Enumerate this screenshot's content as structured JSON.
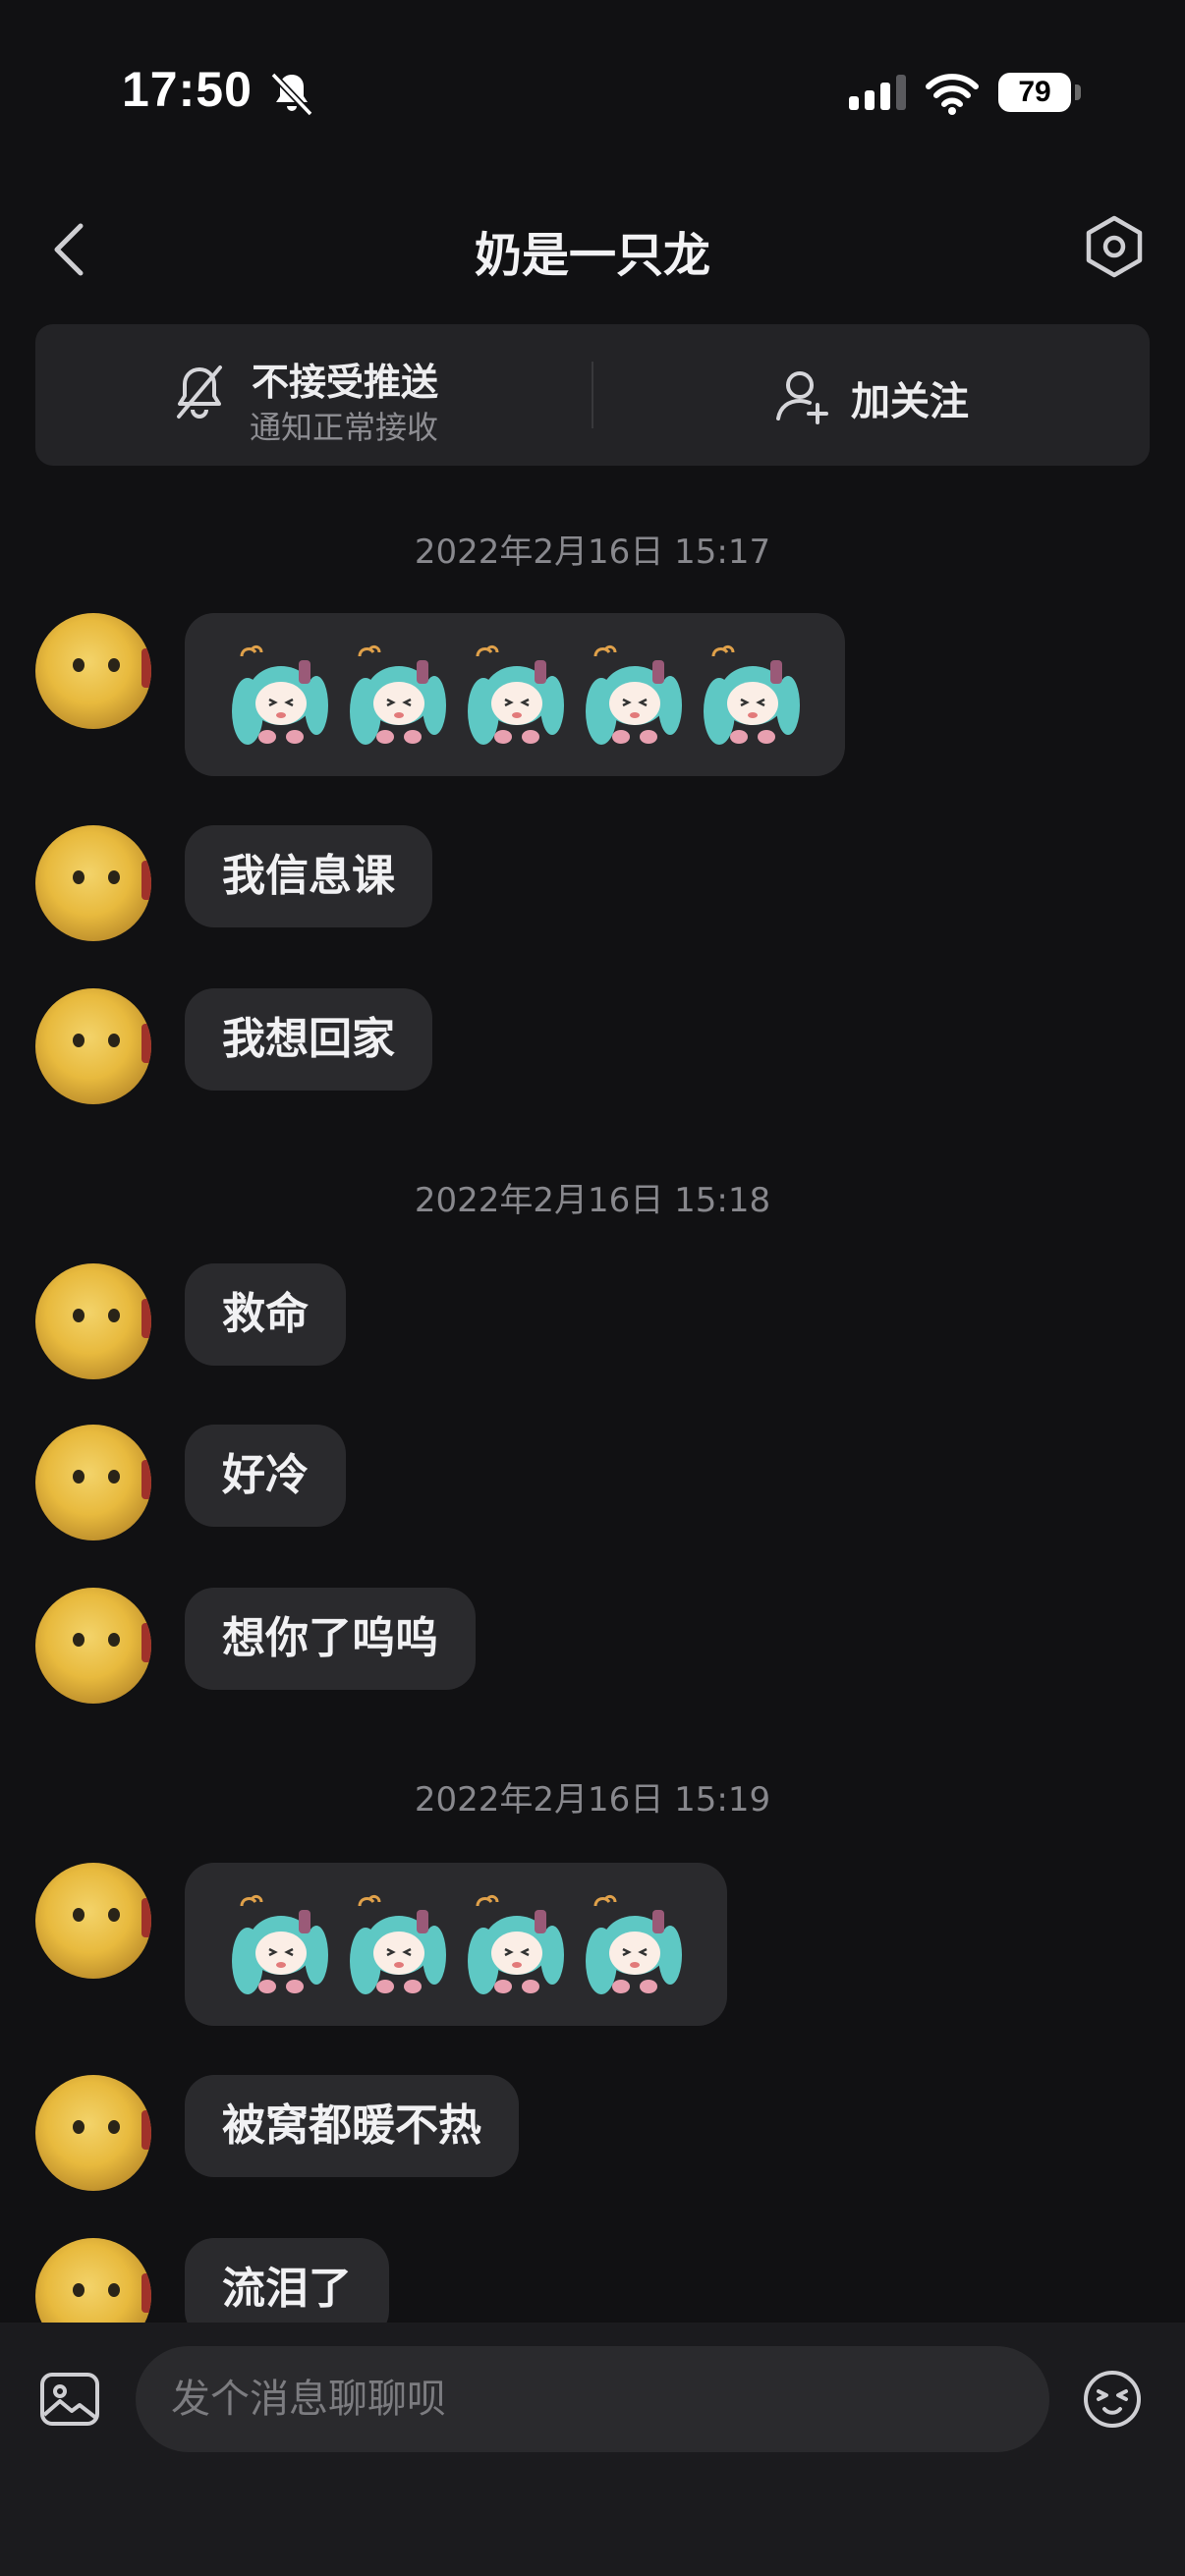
{
  "status_bar": {
    "time": "17:50",
    "battery": "79"
  },
  "header": {
    "title": "奶是一只龙"
  },
  "actions": {
    "mute_title": "不接受推送",
    "mute_subtitle": "通知正常接收",
    "follow_label": "加关注"
  },
  "messages": {
    "ts1": "2022年2月16日 15:17",
    "m2": "我信息课",
    "m3": "我想回家",
    "ts2": "2022年2月16日 15:18",
    "m4": "救命",
    "m5": "好冷",
    "m6": "想你了呜呜",
    "ts3": "2022年2月16日 15:19",
    "m8": "被窝都暖不热",
    "m9": "流泪了"
  },
  "input": {
    "placeholder": "发个消息聊聊呗"
  },
  "icons": {
    "back": "chevron-left-icon",
    "settings": "hexagon-gear-icon",
    "mute": "bell-off-icon",
    "follow": "add-user-icon",
    "image": "image-icon",
    "emoji": "emoji-icon",
    "sticker": "miku-sticker"
  },
  "colors": {
    "background": "#111113",
    "bubble": "#2a2a2d",
    "card": "#232326"
  }
}
